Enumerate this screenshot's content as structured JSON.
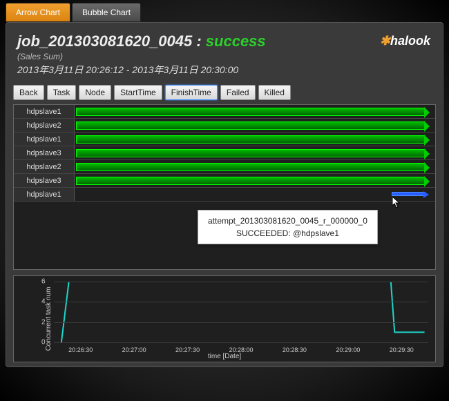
{
  "tabs": {
    "arrow": "Arrow Chart",
    "bubble": "Bubble Chart"
  },
  "header": {
    "job_id": "job_201303081620_0045",
    "sep": " : ",
    "status": "success",
    "subtitle": "(Sales Sum)",
    "timerange": "2013年3月11日 20:26:12 - 2013年3月11日 20:30:00",
    "logo_text": "halook"
  },
  "buttons": {
    "back": "Back",
    "task": "Task",
    "node": "Node",
    "start": "StartTime",
    "finish": "FinishTime",
    "failed": "Failed",
    "killed": "Killed"
  },
  "rows": [
    {
      "label": "hdpslave1"
    },
    {
      "label": "hdpslave2"
    },
    {
      "label": "hdpslave1"
    },
    {
      "label": "hdpslave3"
    },
    {
      "label": "hdpslave2"
    },
    {
      "label": "hdpslave3"
    },
    {
      "label": "hdpslave1"
    }
  ],
  "tooltip": {
    "line1": "attempt_201303081620_0045_r_000000_0",
    "line2": "SUCCEEDED:  @hdpslave1"
  },
  "chart_data": {
    "type": "line",
    "title": "",
    "xlabel": "time [Date]",
    "ylabel": "Concurrent task num",
    "ylim": [
      0,
      6
    ],
    "yticks": [
      0,
      2,
      4,
      6
    ],
    "xticks": [
      "20:26:30",
      "20:27:00",
      "20:27:30",
      "20:28:00",
      "20:28:30",
      "20:29:00",
      "20:29:30"
    ],
    "series": [
      {
        "name": "concurrent tasks",
        "points": [
          {
            "x": 0.02,
            "y": 0
          },
          {
            "x": 0.04,
            "y": 6
          },
          {
            "x": 0.9,
            "y": 6
          },
          {
            "x": 0.91,
            "y": 1
          },
          {
            "x": 0.99,
            "y": 1
          }
        ]
      }
    ],
    "line_color": "#1dd6c9"
  }
}
